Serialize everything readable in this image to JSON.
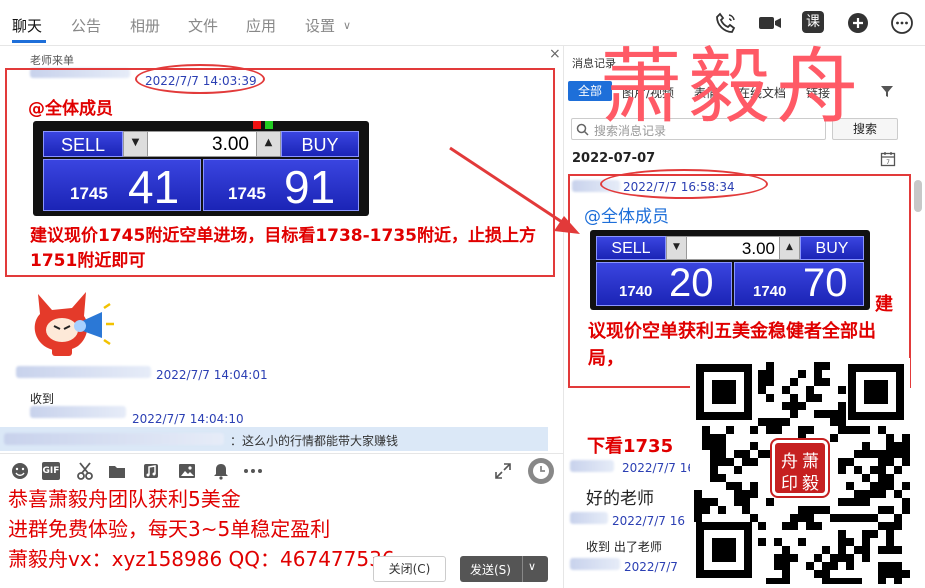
{
  "nav": {
    "tabs": [
      "聊天",
      "公告",
      "相册",
      "文件",
      "应用",
      "设置"
    ],
    "settings_chevron": "∨",
    "icons": [
      "phone-icon",
      "video-call-icon",
      "course-icon",
      "add-icon",
      "more-icon"
    ],
    "course_label": "课"
  },
  "chat": {
    "sender1": "老师来单",
    "msg1_time": "2022/7/7 14:03:39",
    "msg1_mention": "@全体成员",
    "ticket1": {
      "sell": "SELL",
      "buy": "BUY",
      "qty": "3.00",
      "sell_prefix": "1745",
      "sell_big": "41",
      "buy_prefix": "1745",
      "buy_big": "91"
    },
    "msg1_text": "建议现价1745附近空单进场，目标看1738-1735附近，止损上方1751附近即可",
    "msg2_time": "2022/7/7 14:04:01",
    "msg2_text": "收到",
    "msg3_time": "2022/7/7 14:04:10",
    "msg3_text": "：这么小的行情都能带大家赚钱"
  },
  "composer": {
    "icons": [
      "emoji-icon",
      "gif-icon",
      "scissors-icon",
      "folder-icon",
      "music-icon",
      "image-icon",
      "bell-icon",
      "ellipsis-icon"
    ],
    "gif_label": "GIF",
    "promo_lines": [
      "恭喜萧毅舟团队获利5美金",
      "进群免费体验，每天3~5单稳定盈利",
      "萧毅舟vx：xyz158986  QQ：467477536"
    ],
    "close_label": "关闭(C)",
    "send_label": "发送(S)"
  },
  "sidebar": {
    "title": "消息记录",
    "close": "×",
    "filters": [
      "全部",
      "图片/视频",
      "表情",
      "在线文档",
      "链接"
    ],
    "search_placeholder": "搜索消息记录",
    "search_button": "搜索",
    "date": "2022-07-07",
    "rec1_time": "2022/7/7 16:58:34",
    "rec1_mention": "@全体成员",
    "ticket2": {
      "sell": "SELL",
      "buy": "BUY",
      "qty": "3.00",
      "sell_prefix": "1740",
      "sell_big": "20",
      "buy_prefix": "1740",
      "buy_big": "70"
    },
    "rec1_text": "建议现价空单获利五美金稳健者全部出局，",
    "rec1_text_lead": "建",
    "rec1_text_rest": "议现价空单获利五美金稳健者全部出局，",
    "rec2_text": "下看1735",
    "rec3_time": "2022/7/7 16:",
    "rec3_text": "好的老师",
    "rec4_time": "2022/7/7 16",
    "rec4_text": "收到 出了老师",
    "rec5_time": "2022/7/7"
  },
  "watermark": {
    "big_text": "萧毅舟",
    "seal_text": [
      "舟",
      "萧",
      "印",
      "毅"
    ]
  },
  "colors": {
    "accent": "#1e6fd9",
    "highlight": "#e00000",
    "ticket": "#2a34d0"
  }
}
